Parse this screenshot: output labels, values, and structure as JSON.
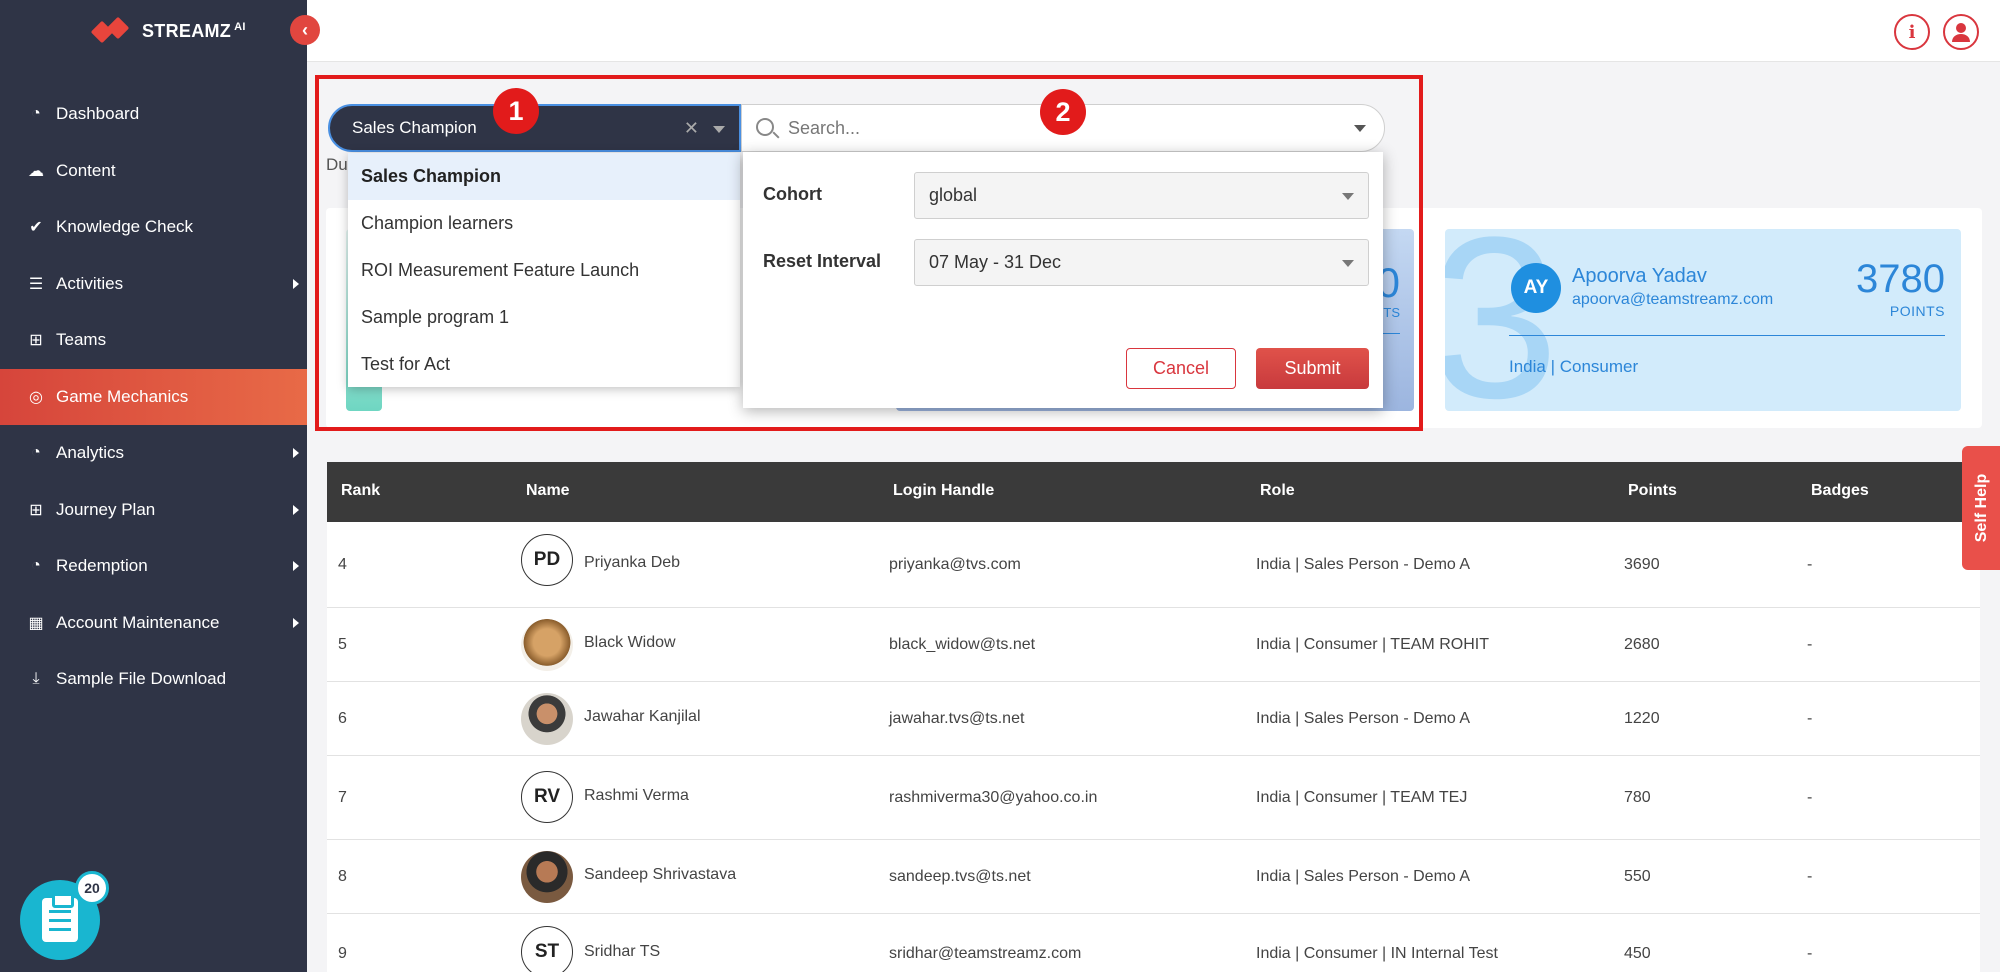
{
  "brand": {
    "name": "STREAMZ",
    "suffix": "AI"
  },
  "sidebar": {
    "items": [
      {
        "label": "Dashboard",
        "icon": "gauge-icon",
        "submenu": false
      },
      {
        "label": "Content",
        "icon": "cloud-upload-icon",
        "submenu": false
      },
      {
        "label": "Knowledge Check",
        "icon": "check-icon",
        "submenu": false
      },
      {
        "label": "Activities",
        "icon": "list-icon",
        "submenu": true
      },
      {
        "label": "Teams",
        "icon": "hierarchy-icon",
        "submenu": false
      },
      {
        "label": "Game Mechanics",
        "icon": "target-icon",
        "submenu": false,
        "active": true
      },
      {
        "label": "Analytics",
        "icon": "gauge-icon",
        "submenu": true
      },
      {
        "label": "Journey Plan",
        "icon": "hierarchy-icon",
        "submenu": true
      },
      {
        "label": "Redemption",
        "icon": "gauge-icon",
        "submenu": true
      },
      {
        "label": "Account Maintenance",
        "icon": "grid-icon",
        "submenu": true
      },
      {
        "label": "Sample File Download",
        "icon": "download-icon",
        "submenu": false
      }
    ],
    "task_count": "20"
  },
  "program_select": {
    "value": "Sales Champion",
    "options": [
      "Sales Champion",
      "Champion learners",
      "ROI Measurement Feature Launch",
      "Sample program 1",
      "Test for Act"
    ]
  },
  "du_text": "Du",
  "search": {
    "placeholder": "Search..."
  },
  "filter": {
    "cohort_label": "Cohort",
    "cohort_value": "global",
    "reset_label": "Reset Interval",
    "reset_value": "07 May - 31 Dec",
    "cancel_label": "Cancel",
    "submit_label": "Submit"
  },
  "markers": [
    "1",
    "2"
  ],
  "podium": {
    "mid_points_fragment": "0",
    "mid_points_label": "TS",
    "third": {
      "rank": "3",
      "initials": "AY",
      "name": "Apoorva Yadav",
      "email": "apoorva@teamstreamz.com",
      "points": "3780",
      "points_label": "POINTS",
      "meta": "India | Consumer"
    }
  },
  "table": {
    "headers": [
      "Rank",
      "Name",
      "Login Handle",
      "Role",
      "Points",
      "Badges"
    ],
    "rows": [
      {
        "rank": "4",
        "initials": "PD",
        "name": "Priyanka Deb",
        "login": "priyanka@tvs.com",
        "role": "India | Sales Person - Demo A",
        "points": "3690",
        "badges": "-"
      },
      {
        "rank": "5",
        "initials": "",
        "name": "Black Widow",
        "login": "black_widow@ts.net",
        "role": "India | Consumer | TEAM ROHIT",
        "points": "2680",
        "badges": "-"
      },
      {
        "rank": "6",
        "initials": "",
        "name": "Jawahar Kanjilal",
        "login": "jawahar.tvs@ts.net",
        "role": "India | Sales Person - Demo A",
        "points": "1220",
        "badges": "-"
      },
      {
        "rank": "7",
        "initials": "RV",
        "name": "Rashmi Verma",
        "login": "rashmiverma30@yahoo.co.in",
        "role": "India | Consumer | TEAM TEJ",
        "points": "780",
        "badges": "-"
      },
      {
        "rank": "8",
        "initials": "",
        "name": "Sandeep Shrivastava",
        "login": "sandeep.tvs@ts.net",
        "role": "India | Sales Person - Demo A",
        "points": "550",
        "badges": "-"
      },
      {
        "rank": "9",
        "initials": "ST",
        "name": "Sridhar TS",
        "login": "sridhar@teamstreamz.com",
        "role": "India | Consumer | IN Internal Test",
        "points": "450",
        "badges": "-"
      }
    ]
  },
  "self_help": "Self Help",
  "colors": {
    "sidebar": "#2f3446",
    "accent": "#e1463f",
    "highlight_frame": "#e21b1b",
    "podium_blue": "#2c86d8"
  }
}
